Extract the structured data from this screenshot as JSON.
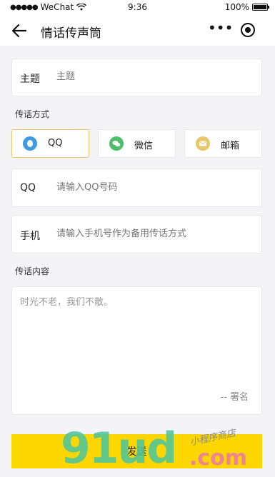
{
  "status_bar": {
    "carrier": "WeChat",
    "time": "9:36",
    "battery": "100%"
  },
  "nav": {
    "title": "情话传声筒"
  },
  "subject": {
    "label": "主题",
    "placeholder": "主题"
  },
  "method_section": {
    "label": "传话方式"
  },
  "methods": [
    {
      "label": "QQ",
      "icon": "qq-icon",
      "color": "#3d9ce0",
      "selected": true
    },
    {
      "label": "微信",
      "icon": "wechat-icon",
      "color": "#4dbf6b",
      "selected": false
    },
    {
      "label": "邮箱",
      "icon": "mail-icon",
      "color": "#e8c66a",
      "selected": false
    }
  ],
  "qq_field": {
    "label": "QQ",
    "placeholder": "请输入QQ号码"
  },
  "phone_field": {
    "label": "手机",
    "placeholder": "请输入手机号作为备用传话方式"
  },
  "content_section": {
    "label": "传话内容"
  },
  "content": {
    "placeholder": "时光不老，我们不散。",
    "signature": "-- 署名"
  },
  "send_button": {
    "label": "发送",
    "color": "#fcd600"
  },
  "watermark": {
    "text_num": "91ud",
    "text_domain": ".com",
    "text_cn": "小程序商店"
  }
}
